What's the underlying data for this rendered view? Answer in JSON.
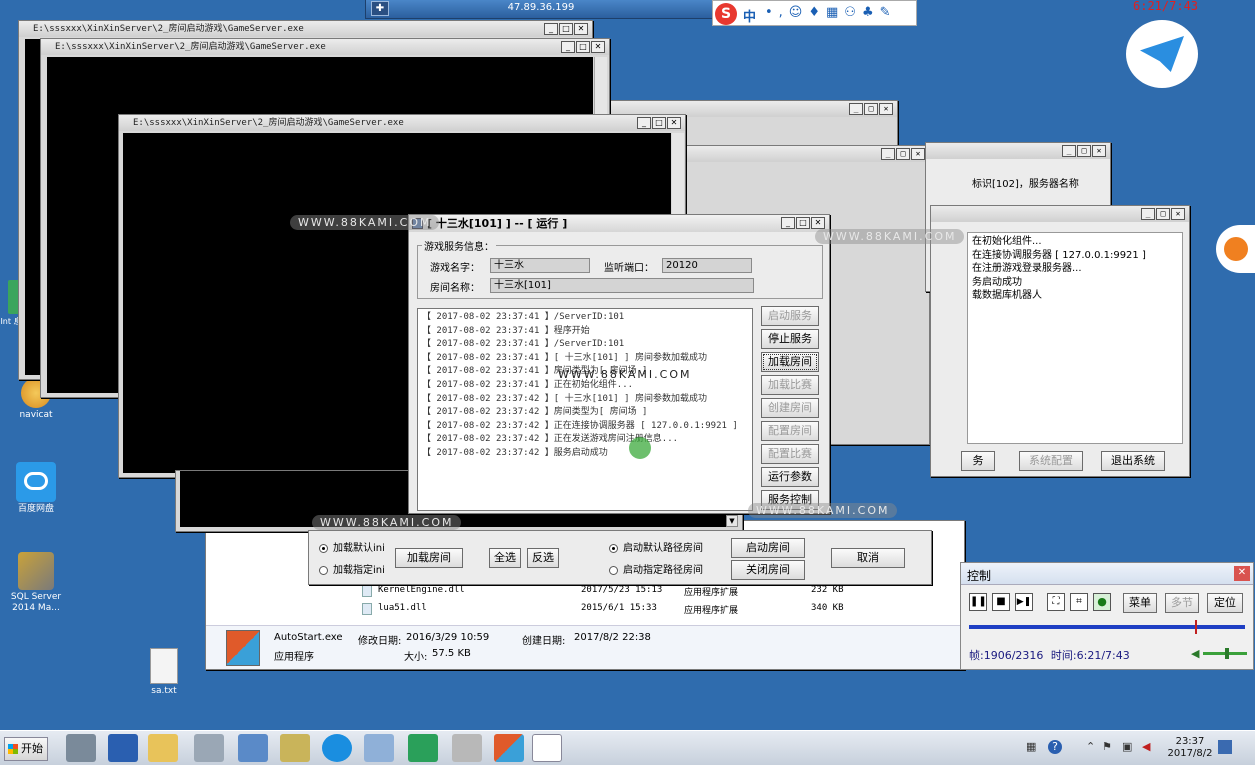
{
  "remote_bar": {
    "ip": "47.89.36.199"
  },
  "clock_overlay": "6:21/7:43",
  "ime_toolbar": {
    "mode": "中"
  },
  "console_windows": [
    {
      "title": "E:\\sssxxx\\XinXinServer\\2_房间启动游戏\\GameServer.exe"
    },
    {
      "title": "E:\\sssxxx\\XinXinServer\\2_房间启动游戏\\GameServer.exe"
    },
    {
      "title": "E:\\sssxxx\\XinXinServer\\2_房间启动游戏\\GameServer.exe"
    }
  ],
  "watermark": "WWW.88KAMI.COM",
  "desktop_icons": [
    {
      "label": "navicat"
    },
    {
      "label": "百度网盘"
    },
    {
      "label": "SQL Server 2014 Ma..."
    },
    {
      "label": "sa.txt"
    },
    {
      "label": "Int 息服"
    }
  ],
  "main_window": {
    "title": "[ 十三水[101] ] -- [ 运行 ]",
    "group_label": "游戏服务信息：",
    "game_name_label": "游戏名字：",
    "game_name": "十三水",
    "port_label": "监听端口：",
    "port": "20120",
    "room_name_label": "房间名称：",
    "room_name": "十三水[101]",
    "log": [
      "【 2017-08-02 23:37:41 】/ServerID:101",
      "【 2017-08-02 23:37:41 】程序开始",
      "【 2017-08-02 23:37:41 】/ServerID:101",
      "【 2017-08-02 23:37:41 】[ 十三水[101] ] 房间参数加载成功",
      "【 2017-08-02 23:37:41 】房间类型为[ 房间场 ]",
      "【 2017-08-02 23:37:41 】正在初始化组件...",
      "【 2017-08-02 23:37:42 】[ 十三水[101] ] 房间参数加载成功",
      "【 2017-08-02 23:37:42 】房间类型为[ 房间场 ]",
      "【 2017-08-02 23:37:42 】正在连接协调服务器 [ 127.0.0.1:9921 ]",
      "【 2017-08-02 23:37:42 】正在发送游戏房间注册信息...",
      "【 2017-08-02 23:37:42 】服务启动成功"
    ],
    "buttons": {
      "start": "启动服务",
      "stop": "停止服务",
      "load_room": "加载房间",
      "load_match": "加载比赛",
      "create_room": "创建房间",
      "config_room": "配置房间",
      "config_match": "配置比赛",
      "run_params": "运行参数",
      "service_ctrl": "服务控制"
    }
  },
  "loader_dialog": {
    "radio_default_ini": "加载默认ini",
    "radio_specified_ini": "加载指定ini",
    "load_room": "加载房间",
    "select_all": "全选",
    "invert": "反选",
    "radio_default_path": "启动默认路径房间",
    "radio_specified_path": "启动指定路径房间",
    "start_room": "启动房间",
    "close_room": "关闭房间",
    "cancel": "取消"
  },
  "file_list": {
    "rows": [
      {
        "name": "KernelEngine.dll",
        "date": "2017/5/23 15:13",
        "type": "应用程序扩展",
        "size": "232 KB"
      },
      {
        "name": "lua51.dll",
        "date": "2015/6/1 15:33",
        "type": "应用程序扩展",
        "size": "340 KB"
      }
    ],
    "details": {
      "name": "AutoStart.exe",
      "modified_label": "修改日期:",
      "modified": "2016/3/29 10:59",
      "created_label": "创建日期:",
      "created": "2017/8/2 22:38",
      "type": "应用程序",
      "size_label": "大小:",
      "size": "57.5 KB"
    }
  },
  "coordinator_window": {
    "log": [
      "在初始化组件...",
      "在连接协调服务器 [ 127.0.0.1:9921 ]",
      "在注册游戏登录服务器...",
      "务启动成功",
      "载数据库机器人"
    ],
    "btn_service": "务",
    "btn_config": "系统配置",
    "btn_exit": "退出系统"
  },
  "login_window": {
    "text1": "标识[102]，服务器名称"
  },
  "control_panel": {
    "title": "控制",
    "menu": "菜单",
    "multi": "多节",
    "locate": "定位",
    "frame_label": "帧:",
    "frame": "1906/2316",
    "time_label": "时间:",
    "time": "6:21/7:43",
    "progress": 0.82,
    "volume": 0.5
  },
  "taskbar": {
    "start": "开始",
    "time": "23:37",
    "date": "2017/8/2"
  }
}
